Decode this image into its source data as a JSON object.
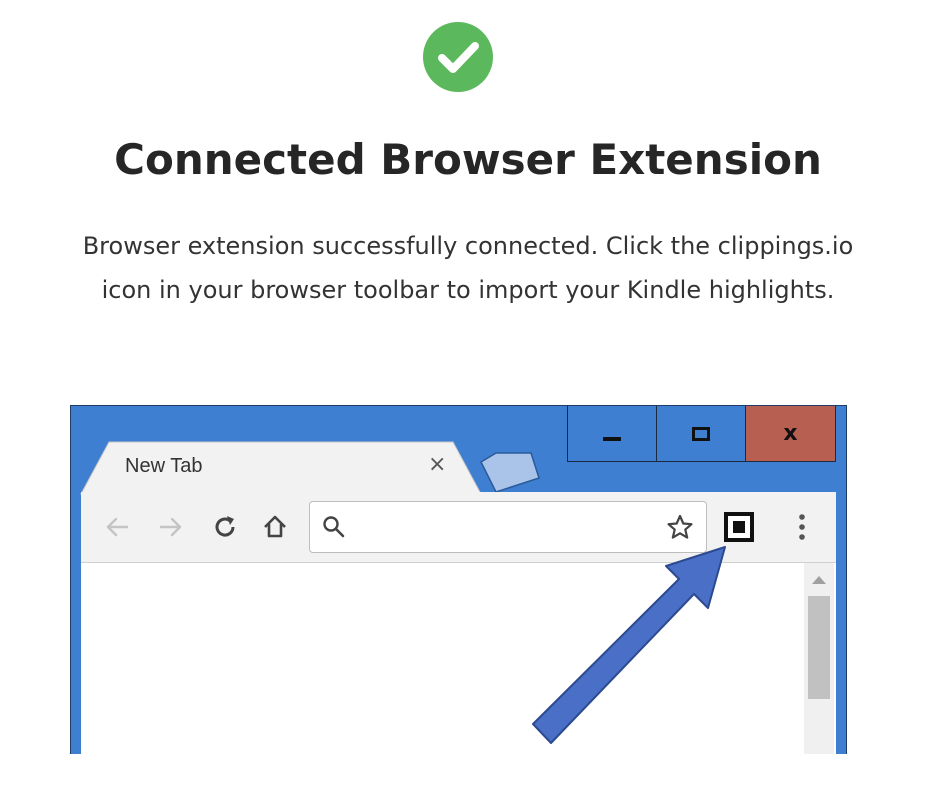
{
  "header": {
    "title": "Connected Browser Extension",
    "description_line1": "Browser extension successfully connected. Click the clippings.io",
    "description_line2": "icon in your browser toolbar to import your Kindle highlights."
  },
  "colors": {
    "success": "#5cb85c",
    "chrome_blue": "#3f7fd1",
    "close_red": "#b76052",
    "arrow_blue": "#4a6fc7"
  },
  "illustration": {
    "tab_title": "New Tab",
    "tab_close": "×",
    "window_close": "x",
    "icons": [
      "back-arrow-icon",
      "forward-arrow-icon",
      "reload-icon",
      "home-icon",
      "search-icon",
      "star-icon",
      "extension-icon",
      "menu-dots-icon"
    ],
    "omnibox_value": ""
  }
}
